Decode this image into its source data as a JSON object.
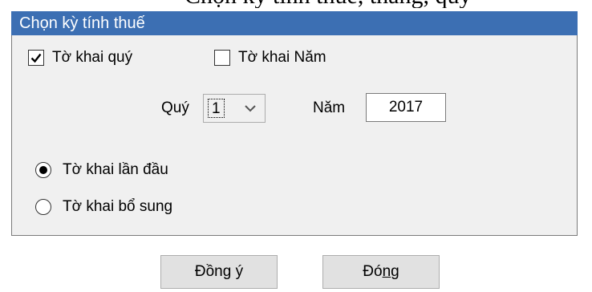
{
  "cropped_heading": "Chọn kỳ tính thuế, tháng, quý",
  "group": {
    "title": "Chọn kỳ tính thuế",
    "header_color": "#3c6fb3"
  },
  "declaration_type": {
    "quarterly": {
      "label": "Tờ khai quý",
      "checked": true
    },
    "annual": {
      "label": "Tờ khai Năm",
      "checked": false
    }
  },
  "period": {
    "quarter_label": "Quý",
    "quarter_value": "1",
    "year_label": "Năm",
    "year_value": "2017"
  },
  "submission": {
    "first": {
      "label": "Tờ khai lần đầu",
      "selected": true
    },
    "supplement": {
      "label": "Tờ khai bổ sung",
      "selected": false
    }
  },
  "buttons": {
    "agree": {
      "pre": "Đồn",
      "mnemonic": "g",
      "post": " ý"
    },
    "close": {
      "pre": "Đó",
      "mnemonic": "n",
      "post": "g"
    }
  }
}
